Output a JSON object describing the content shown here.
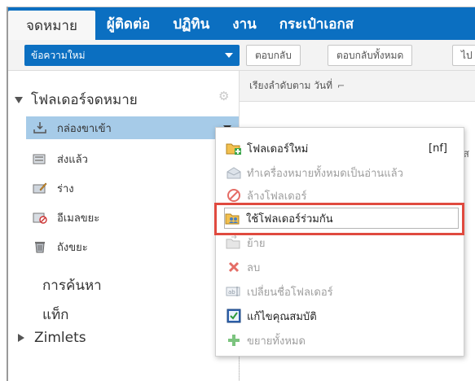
{
  "apptabs": [
    {
      "label": "จดหมาย",
      "active": true
    },
    {
      "label": "ผู้ติดต่อ",
      "active": false
    },
    {
      "label": "ปฏิทิน",
      "active": false
    },
    {
      "label": "งาน",
      "active": false
    },
    {
      "label": "กระเป๋าเอกส",
      "active": false
    }
  ],
  "toolbar": {
    "new_message": "ข้อความใหม่",
    "reply": "ตอบกลับ",
    "reply_all": "ตอบกลับทั้งหมด",
    "forward_partial": "ไป"
  },
  "tree": {
    "header": "โฟลเดอร์จดหมาย",
    "folders": [
      {
        "label": "กล่องขาเข้า",
        "icon": "inbox-icon",
        "selected": true
      },
      {
        "label": "ส่งแล้ว",
        "icon": "sent-icon",
        "selected": false
      },
      {
        "label": "ร่าง",
        "icon": "drafts-icon",
        "selected": false
      },
      {
        "label": "อีเมลขยะ",
        "icon": "junk-icon",
        "selected": false
      },
      {
        "label": "ถังขยะ",
        "icon": "trash-icon",
        "selected": false
      }
    ],
    "search": "การค้นหา",
    "tags": "แท็ก",
    "zimlets": "Zimlets"
  },
  "sortbar": {
    "label": "เรียงลำดับตาม วันที่"
  },
  "right_partial": "ส",
  "context_menu": {
    "items": [
      {
        "label": "โฟลเดอร์ใหม่",
        "shortcut": "[nf]",
        "icon": "new-folder-icon",
        "disabled": false
      },
      {
        "label": "ทำเครื่องหมายทั้งหมดเป็นอ่านแล้ว",
        "icon": "mark-read-icon",
        "disabled": true
      },
      {
        "label": "ล้างโฟลเดอร์",
        "icon": "empty-folder-icon",
        "disabled": true
      },
      {
        "label": "ใช้โฟลเดอร์ร่วมกัน",
        "icon": "share-folder-icon",
        "disabled": false,
        "highlight": true
      },
      {
        "label": "ย้าย",
        "icon": "move-icon",
        "disabled": true
      },
      {
        "label": "ลบ",
        "icon": "delete-icon",
        "disabled": true
      },
      {
        "label": "เปลี่ยนชื่อโฟลเดอร์",
        "icon": "rename-icon",
        "disabled": true
      },
      {
        "label": "แก้ไขคุณสมบัติ",
        "icon": "edit-properties-icon",
        "disabled": false
      },
      {
        "label": "ขยายทั้งหมด",
        "icon": "expand-all-icon",
        "disabled": true
      }
    ]
  },
  "colors": {
    "brand_blue": "#0b6fc1",
    "selected_row": "#a6cbe8",
    "annotation_red": "#e04a3f"
  }
}
